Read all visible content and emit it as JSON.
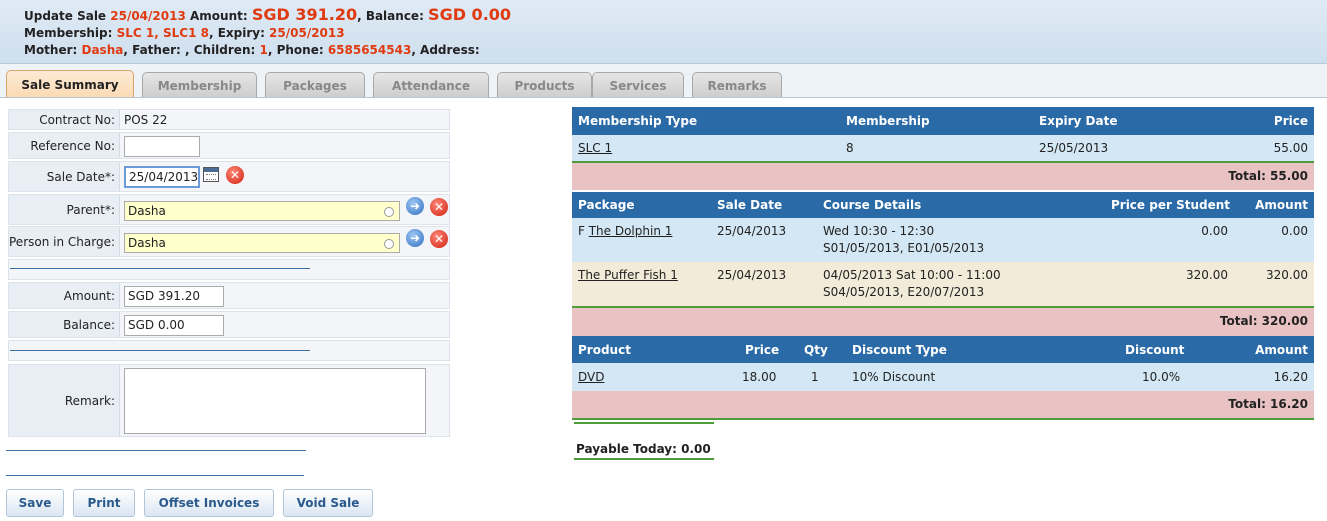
{
  "header": {
    "line1": {
      "prefix": "Update Sale ",
      "date": "25/04/2013",
      "amount_label": " Amount: ",
      "amount": "SGD 391.20",
      "balance_label": ", Balance: ",
      "balance": "SGD 0.00"
    },
    "line2": {
      "membership_label": "Membership: ",
      "membership": "SLC 1, SLC1 8",
      "expiry_label": ", Expiry: ",
      "expiry": "25/05/2013"
    },
    "line3": {
      "mother_label": "Mother: ",
      "mother": "Dasha",
      "mid": ", Father: , Children: ",
      "children": "1",
      "phone_label": ", Phone: ",
      "phone": "6585654543",
      "address_label": ", Address:"
    }
  },
  "tabs": [
    "Sale Summary",
    "Membership",
    "Packages",
    "Attendance",
    "Products",
    "Services",
    "Remarks"
  ],
  "form": {
    "contract_label": "Contract No:",
    "contract_value": "POS 22",
    "reference_label": "Reference No:",
    "reference_value": "",
    "sale_date_label": "Sale Date*:",
    "sale_date_value": "25/04/2013",
    "parent_label": "Parent*:",
    "parent_value": "Dasha",
    "pic_label": "Person in Charge:",
    "pic_value": "Dasha",
    "amount_label": "Amount:",
    "amount_value": "SGD 391.20",
    "balance_label": "Balance:",
    "balance_value": "SGD 0.00",
    "remark_label": "Remark:",
    "remark_value": ""
  },
  "buttons": {
    "save": "Save",
    "print": "Print",
    "offset": "Offset Invoices",
    "void": "Void Sale"
  },
  "membership_table": {
    "headers": [
      "Membership Type",
      "Membership",
      "Expiry Date",
      "Price"
    ],
    "rows": [
      {
        "type": "SLC 1",
        "membership": "8",
        "expiry": "25/05/2013",
        "price": "55.00"
      }
    ],
    "total": "Total: 55.00"
  },
  "package_table": {
    "headers": [
      "Package",
      "Sale Date",
      "Course Details",
      "Price per Student",
      "Amount"
    ],
    "rows": [
      {
        "prefix": "F ",
        "name": "The Dolphin 1",
        "sale_date": "25/04/2013",
        "details1": "Wed 10:30 - 12:30",
        "details2": "S01/05/2013, E01/05/2013",
        "price": "0.00",
        "amount": "0.00"
      },
      {
        "prefix": "",
        "name": "The Puffer Fish 1",
        "sale_date": "25/04/2013",
        "details1": "04/05/2013 Sat 10:00 - 11:00",
        "details2": "S04/05/2013, E20/07/2013",
        "price": "320.00",
        "amount": "320.00"
      }
    ],
    "total": "Total: 320.00"
  },
  "product_table": {
    "headers": [
      "Product",
      "Price",
      "Qty",
      "Discount Type",
      "Discount",
      "Amount"
    ],
    "rows": [
      {
        "product": "DVD",
        "price": "18.00",
        "qty": "1",
        "discount_type": "10% Discount",
        "discount": "10.0%",
        "amount": "16.20"
      }
    ],
    "total": "Total: 16.20"
  },
  "payable_today": "Payable Today: 0.00",
  "colors": {
    "accent_red": "#e03a10",
    "table_header": "#2a6aa6",
    "row_blue": "#d3e8f4",
    "row_cream": "#f2ebd9",
    "total_pink": "#e9c3c3"
  }
}
